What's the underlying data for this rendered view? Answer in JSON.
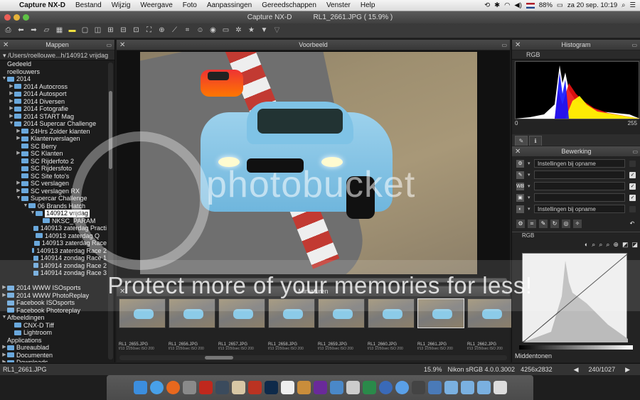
{
  "menubar": {
    "apple": "",
    "app": "Capture NX-D",
    "items": [
      "Bestand",
      "Wijzig",
      "Weergave",
      "Foto",
      "Aanpassingen",
      "Gereedschappen",
      "Venster",
      "Help"
    ],
    "battery": "88%",
    "datetime": "za 20 sep.  10:19"
  },
  "window": {
    "title": "Capture NX-D",
    "file_title": "RL1_2661.JPG ( 15.9% )"
  },
  "folders": {
    "title": "Mappen",
    "path": "/Users/roellouwe...h/140912 vrijdag",
    "items": [
      {
        "label": "Gedeeld",
        "indent": 0,
        "arrow": "",
        "folder": false
      },
      {
        "label": "roellouwers",
        "indent": 0,
        "arrow": "",
        "folder": false
      },
      {
        "label": "2014",
        "indent": 0,
        "arrow": "▼",
        "folder": true
      },
      {
        "label": "2014 Autocross",
        "indent": 1,
        "arrow": "▶",
        "folder": true
      },
      {
        "label": "2014 Autosport",
        "indent": 1,
        "arrow": "▶",
        "folder": true
      },
      {
        "label": "2014 Diversen",
        "indent": 1,
        "arrow": "▶",
        "folder": true
      },
      {
        "label": "2014 Fotografie",
        "indent": 1,
        "arrow": "▶",
        "folder": true
      },
      {
        "label": "2014 START Mag",
        "indent": 1,
        "arrow": "▶",
        "folder": true
      },
      {
        "label": "2014 Supercar Challenge",
        "indent": 1,
        "arrow": "▼",
        "folder": true
      },
      {
        "label": "24Hrs Zolder klanten",
        "indent": 2,
        "arrow": "▶",
        "folder": true
      },
      {
        "label": "Klantenverslagen",
        "indent": 2,
        "arrow": "▶",
        "folder": true
      },
      {
        "label": "SC Berry",
        "indent": 2,
        "arrow": "",
        "folder": true
      },
      {
        "label": "SC Klanten",
        "indent": 2,
        "arrow": "▶",
        "folder": true
      },
      {
        "label": "SC Rijderfoto 2",
        "indent": 2,
        "arrow": "",
        "folder": true
      },
      {
        "label": "SC Rijdersfoto",
        "indent": 2,
        "arrow": "",
        "folder": true
      },
      {
        "label": "SC Site foto's",
        "indent": 2,
        "arrow": "",
        "folder": true
      },
      {
        "label": "SC verslagen",
        "indent": 2,
        "arrow": "▶",
        "folder": true
      },
      {
        "label": "SC verslagen RX",
        "indent": 2,
        "arrow": "▶",
        "folder": true
      },
      {
        "label": "Supercar Challenge",
        "indent": 2,
        "arrow": "▼",
        "folder": true
      },
      {
        "label": "06 Brands Hatch",
        "indent": 3,
        "arrow": "▼",
        "folder": true
      },
      {
        "label": "140912 vrijdag",
        "indent": 4,
        "arrow": "▼",
        "folder": true,
        "selected": true
      },
      {
        "label": "NKSC_PARAM",
        "indent": 5,
        "arrow": "",
        "folder": true
      },
      {
        "label": "140913 zaterdag Practi",
        "indent": 4,
        "arrow": "",
        "folder": true
      },
      {
        "label": "140913 zaterdag Q",
        "indent": 4,
        "arrow": "",
        "folder": true
      },
      {
        "label": "140913 zaterdag Race",
        "indent": 4,
        "arrow": "",
        "folder": true
      },
      {
        "label": "140913 zaterdag Race 2",
        "indent": 4,
        "arrow": "",
        "folder": true
      },
      {
        "label": "140914 zondag Race 1",
        "indent": 4,
        "arrow": "",
        "folder": true
      },
      {
        "label": "140914 zondag Race 2",
        "indent": 4,
        "arrow": "",
        "folder": true
      },
      {
        "label": "140914 zondag Race 3",
        "indent": 4,
        "arrow": "",
        "folder": true
      },
      {
        "label": "",
        "indent": 0,
        "arrow": "",
        "folder": false
      },
      {
        "label": "2014 WWW ISOsports",
        "indent": 0,
        "arrow": "▶",
        "folder": true
      },
      {
        "label": "2014 WWW PhotoReplay",
        "indent": 0,
        "arrow": "▶",
        "folder": true
      },
      {
        "label": "Facebook ISOsports",
        "indent": 0,
        "arrow": "",
        "folder": true
      },
      {
        "label": "Facebook Photoreplay",
        "indent": 0,
        "arrow": "",
        "folder": true
      },
      {
        "label": "Afbeeldingen",
        "indent": 0,
        "arrow": "▼",
        "folder": false
      },
      {
        "label": "CNX-D Tiff",
        "indent": 1,
        "arrow": "",
        "folder": true
      },
      {
        "label": "Lightroom",
        "indent": 1,
        "arrow": "",
        "folder": true
      },
      {
        "label": "Applications",
        "indent": 0,
        "arrow": "",
        "folder": false
      },
      {
        "label": "Bureaublad",
        "indent": 0,
        "arrow": "▶",
        "folder": true
      },
      {
        "label": "Documenten",
        "indent": 0,
        "arrow": "▶",
        "folder": true
      },
      {
        "label": "Downloads",
        "indent": 0,
        "arrow": "▶",
        "folder": true
      }
    ]
  },
  "preview": {
    "title": "Voorbeeld"
  },
  "thumbnails": {
    "title": "Miniaturen",
    "items": [
      {
        "name": "RL1_2655.JPG",
        "info": "f/13 1/250sec ISO 200"
      },
      {
        "name": "RL1_2656.JPG",
        "info": "f/13 1/250sec ISO 200"
      },
      {
        "name": "RL1_2657.JPG",
        "info": "f/13 1/250sec ISO 200"
      },
      {
        "name": "RL1_2658.JPG",
        "info": "f/13 1/250sec ISO 200"
      },
      {
        "name": "RL1_2659.JPG",
        "info": "f/13 1/250sec ISO 200"
      },
      {
        "name": "RL1_2660.JPG",
        "info": "f/13 1/250sec ISO 200"
      },
      {
        "name": "RL1_2661.JPG",
        "info": "f/13 1/250sec ISO 200",
        "selected": true
      },
      {
        "name": "RL1_2662.JPG",
        "info": "f/13 1/250sec ISO 200"
      }
    ]
  },
  "histogram": {
    "title": "Histogram",
    "channel": "RGB",
    "min": "0",
    "max": "255"
  },
  "edit": {
    "title": "Bewerking",
    "rows": [
      {
        "icon": "⚙",
        "value": "Instellingen bij opname",
        "check": false
      },
      {
        "icon": "✎",
        "value": "",
        "check": true
      },
      {
        "icon": "WB",
        "value": "",
        "check": true
      },
      {
        "icon": "▣",
        "value": "",
        "check": true
      },
      {
        "icon": "◐",
        "value": "Instellingen bij opname",
        "check": false
      }
    ],
    "curve_channel": "RGB",
    "midtone_label": "Middentonen"
  },
  "status": {
    "file": "RL1_2661.JPG",
    "zoom": "15.9%",
    "profile": "Nikon sRGB 4.0.0.3002",
    "dims": "4256x2832",
    "counter": "240/1027"
  },
  "watermark": {
    "logo": "photobucket",
    "banner": "Protect more of your memories for less!"
  },
  "colors": {
    "accent": "#6aa8dc",
    "histo_red": "#e11",
    "histo_yellow": "#ff0",
    "histo_blue": "#11f"
  }
}
